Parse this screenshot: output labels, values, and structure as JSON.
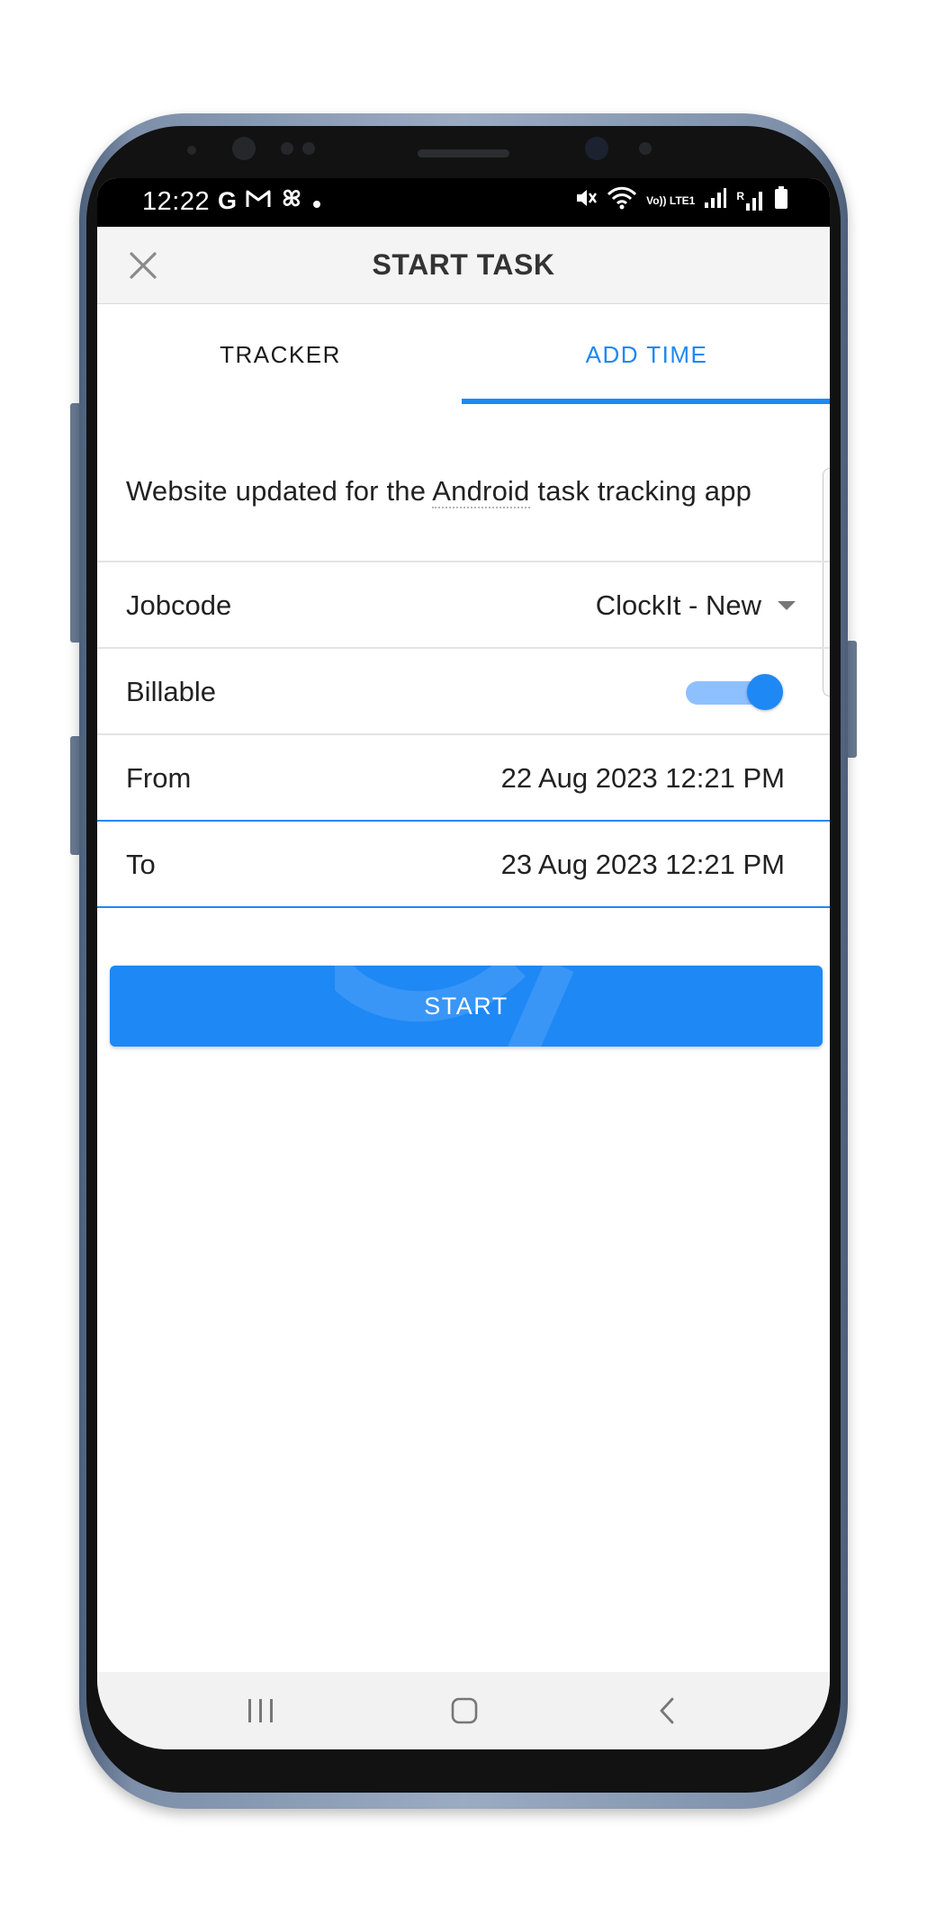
{
  "status_bar": {
    "time": "12:22",
    "left_icons": [
      "g-icon",
      "gmail-icon",
      "pinwheel-icon",
      "dot-icon"
    ],
    "right_icons": [
      "mute-icon",
      "wifi-icon",
      "volte-icon",
      "signal-icon",
      "signal-roaming-icon",
      "battery-icon"
    ],
    "volte_text": "Vo)) LTE1",
    "roaming_text": "R"
  },
  "app_bar": {
    "title": "START TASK",
    "close_icon": "close-icon"
  },
  "tabs": [
    {
      "label": "TRACKER",
      "active": false
    },
    {
      "label": "ADD TIME",
      "active": true
    }
  ],
  "task": {
    "description_before": "Website updated for the ",
    "description_underlined": "Android",
    "description_after": " task tracking app"
  },
  "form": {
    "jobcode": {
      "label": "Jobcode",
      "value": "ClockIt - New"
    },
    "billable": {
      "label": "Billable",
      "on": true
    },
    "from": {
      "label": "From",
      "value": "22 Aug 2023 12:21 PM"
    },
    "to": {
      "label": "To",
      "value": "23 Aug 2023 12:21 PM"
    }
  },
  "actions": {
    "start_label": "START"
  },
  "nav_bar": {
    "icons": [
      "recents-icon",
      "home-icon",
      "back-icon"
    ]
  },
  "colors": {
    "accent": "#1e88f5",
    "toggle_track": "#8ec0ff",
    "app_bar_bg": "#f4f4f4",
    "phone_frame": "#7d8fa9"
  }
}
